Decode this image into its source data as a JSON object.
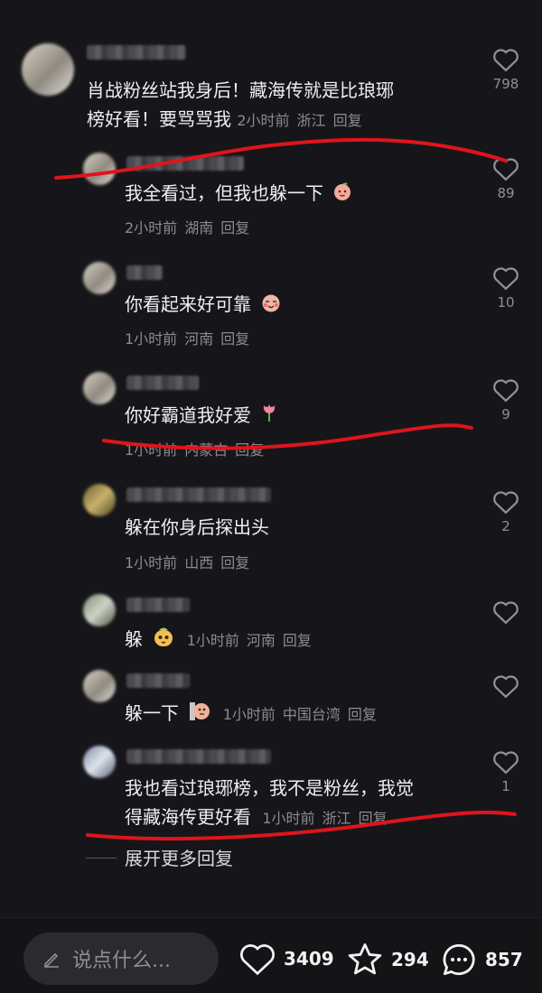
{
  "main_comment": {
    "text_line1": "肖战粉丝站我身后！藏海传就是比琅琊",
    "text_line2": "榜好看！要骂骂我",
    "time": "2小时前",
    "location": "浙江",
    "reply": "回复",
    "likes": "798"
  },
  "replies": [
    {
      "text": "我全看过，但我也躲一下",
      "emoji": "peach-face",
      "time": "2小时前",
      "location": "湖南",
      "reply": "回复",
      "likes": "89"
    },
    {
      "text": "你看起来好可靠",
      "emoji": "shy-peach",
      "time": "1小时前",
      "location": "河南",
      "reply": "回复",
      "likes": "10"
    },
    {
      "text": "你好霸道我好爱",
      "emoji": "tulip",
      "time": "1小时前",
      "location": "内蒙古",
      "reply": "回复",
      "likes": "9"
    },
    {
      "text": "躲在你身后探出头",
      "time": "1小时前",
      "location": "山西",
      "reply": "回复",
      "likes": "2"
    },
    {
      "text": "躲",
      "emoji": "hiding-face",
      "time": "1小时前",
      "location": "河南",
      "reply": "回复",
      "likes": ""
    },
    {
      "text": "躲一下",
      "emoji": "peeking-face",
      "time": "1小时前",
      "location": "中国台湾",
      "reply": "回复",
      "likes": ""
    },
    {
      "text_line1": "我也看过琅琊榜，我不是粉丝，我觉",
      "text_line2": "得藏海传更好看",
      "time": "1小时前",
      "location": "浙江",
      "reply": "回复",
      "likes": "1"
    }
  ],
  "expand_label": "展开更多回复",
  "bottom_bar": {
    "placeholder": "说点什么...",
    "likes": "3409",
    "favorites": "294",
    "comments": "857"
  },
  "annotation_color": "#e0141c"
}
